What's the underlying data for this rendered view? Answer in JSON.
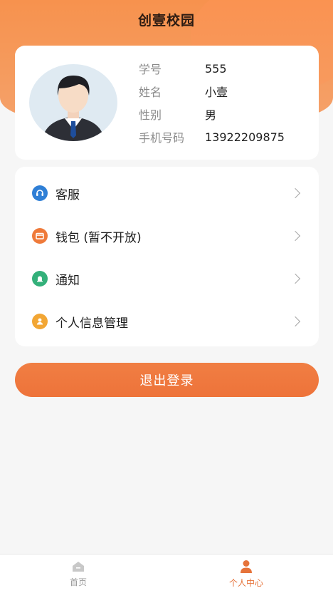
{
  "app": {
    "title": "创壹校园"
  },
  "profile": {
    "fields": [
      {
        "label": "学号",
        "value": "555"
      },
      {
        "label": "姓名",
        "value": "小壹"
      },
      {
        "label": "性别",
        "value": "男"
      },
      {
        "label": "手机号码",
        "value": "13922209875"
      }
    ]
  },
  "menu": {
    "items": [
      {
        "label": "客服",
        "icon": "headset-icon",
        "color": "#2f7fd6"
      },
      {
        "label": "钱包 (暂不开放)",
        "icon": "wallet-icon",
        "color": "#ef7a3a"
      },
      {
        "label": "通知",
        "icon": "bell-icon",
        "color": "#33b07a"
      },
      {
        "label": "个人信息管理",
        "icon": "person-icon",
        "color": "#f2a634"
      }
    ]
  },
  "logout": {
    "label": "退出登录"
  },
  "tabbar": {
    "items": [
      {
        "label": "首页",
        "icon": "home-icon",
        "active": false
      },
      {
        "label": "个人中心",
        "icon": "user-icon",
        "active": true
      }
    ]
  },
  "colors": {
    "accent": "#ef7a3a",
    "header": "#f7924e",
    "inactive": "#9a9a9a"
  }
}
